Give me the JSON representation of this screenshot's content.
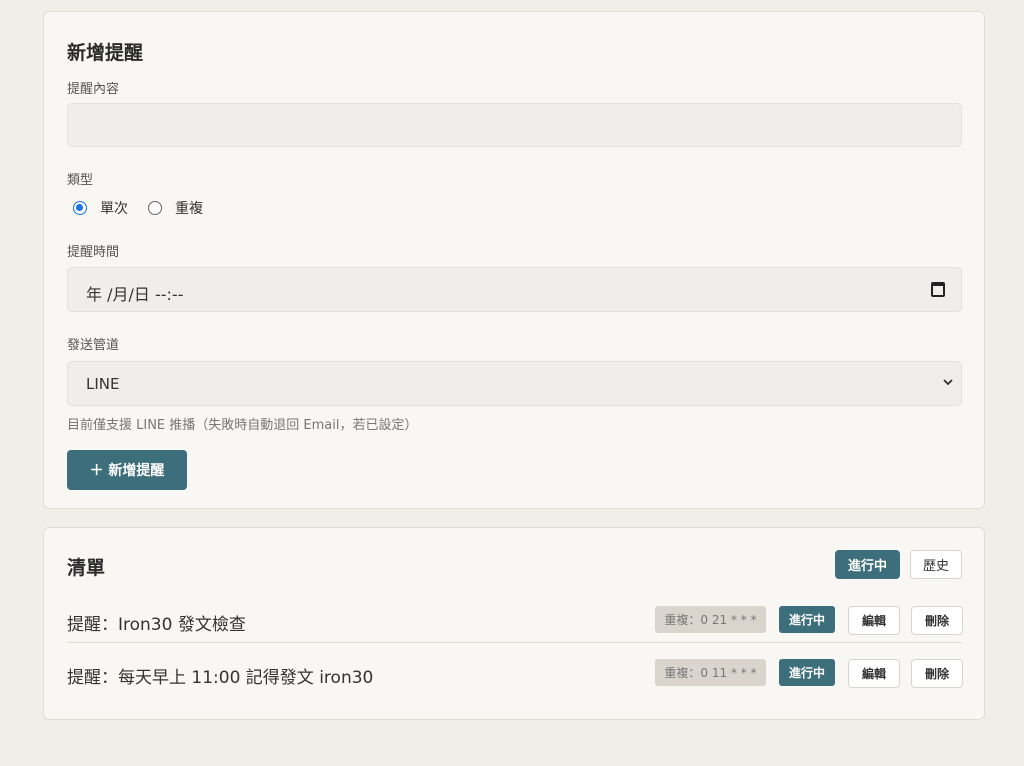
{
  "create": {
    "title": "新增提醒",
    "content_label": "提醒內容",
    "content_value": "",
    "type_label": "類型",
    "type_options": [
      "單次",
      "重複"
    ],
    "type_selected": "單次",
    "time_label": "提醒時間",
    "time_placeholder": "年 /月/日 --:--",
    "channel_label": "發送管道",
    "channel_value": "LINE",
    "channel_hint": "目前僅支援 LINE 推播（失敗時自動退回 Email，若已設定）",
    "submit_label": "＋ 新增提醒"
  },
  "list": {
    "title": "清單",
    "tabs": [
      "進行中",
      "歷史"
    ],
    "active_tab": "進行中",
    "items": [
      {
        "text": "提醒：Iron30 發文檢查",
        "schedule": "重複：0 21 * * *",
        "status": "進行中",
        "edit_label": "編輯",
        "delete_label": "刪除"
      },
      {
        "text": "提醒：每天早上 11:00 記得發文 iron30",
        "schedule": "重複：0 11 * * *",
        "status": "進行中",
        "edit_label": "編輯",
        "delete_label": "刪除"
      }
    ]
  },
  "colors": {
    "accent": "#3c6e7c",
    "page_bg": "#efeee9",
    "card_bg": "#f8f7f4",
    "radio_accent": "#1a73e8"
  }
}
